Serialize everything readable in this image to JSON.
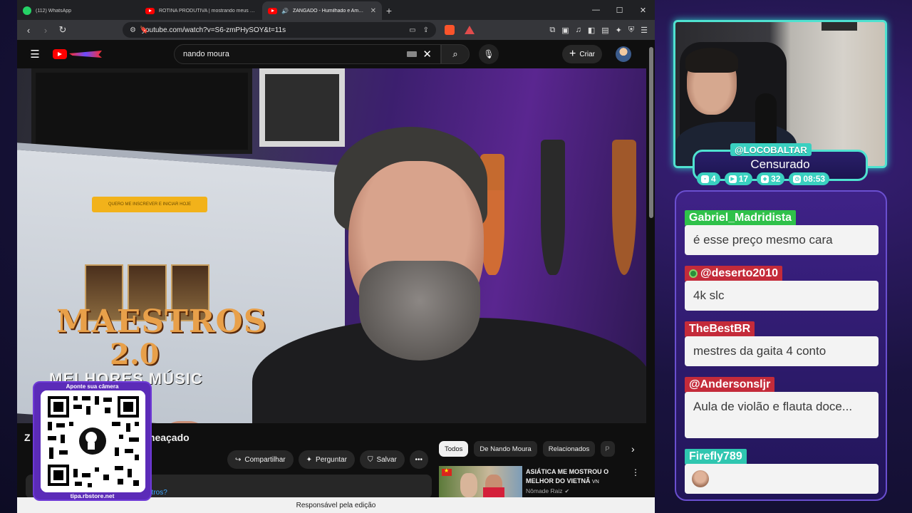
{
  "browser": {
    "tabs": [
      {
        "label": "(112) WhatsApp",
        "icon": "whatsapp-icon"
      },
      {
        "label": "ROTINA PRODUTIVA | mostrando meus hábi",
        "icon": "youtube-icon"
      },
      {
        "label": "ZANGADO - Humilhado e Ameaça",
        "icon": "youtube-icon",
        "active": true
      }
    ],
    "url": "youtube.com/watch?v=S6-zmPHySOY&t=11s"
  },
  "youtube": {
    "search_value": "nando moura",
    "create_label": "Criar",
    "video_title_start": "Z",
    "video_title_end": "meaçado",
    "actions": {
      "share": "Compartilhar",
      "ask": "Perguntar",
      "save": "Salvar"
    },
    "description_peek": "estros?",
    "chips": [
      "Todos",
      "De Nando Moura",
      "Relacionados",
      "P"
    ],
    "recommended": {
      "title": "ASIÁTICA ME MOSTROU O MELHOR DO VIETNÃ",
      "title_suffix": "VN",
      "channel": "Nômade Raiz"
    },
    "bottom_bar": "Responsável pela edição"
  },
  "video_frame": {
    "cta_button": "QUERO ME INSCREVER E INICIAR HOJE",
    "maestros": "MAESTROS",
    "version": "2.0",
    "melhores": "MELHORES MÚSIC"
  },
  "qr_overlay": {
    "header": "Aponte sua câmera",
    "footer": "tipa.rbstore.net"
  },
  "stream": {
    "handle": "@LOCOBALTAR",
    "title": "Censurado",
    "stats": [
      {
        "icon": "chat-icon",
        "value": "4"
      },
      {
        "icon": "youtube-icon",
        "value": "17"
      },
      {
        "icon": "kick-icon",
        "value": "32"
      },
      {
        "icon": "clock-icon",
        "value": "08:53"
      }
    ]
  },
  "chat": {
    "messages": [
      {
        "user": "Gabriel_Madridista",
        "text": "é esse preço mesmo cara",
        "color": "#2fc14a"
      },
      {
        "user": "@deserto2010",
        "text": "4k slc",
        "color": "#c42b3a"
      },
      {
        "user": "TheBestBR",
        "text": "mestres da gaita 4 conto",
        "color": "#c42b3a"
      },
      {
        "user": "@Andersonsljr",
        "text": "Aula de violão e flauta doce...",
        "color": "#c42b3a"
      },
      {
        "user": "Firefly789",
        "text": "",
        "color": "#2fc6b0"
      }
    ]
  }
}
